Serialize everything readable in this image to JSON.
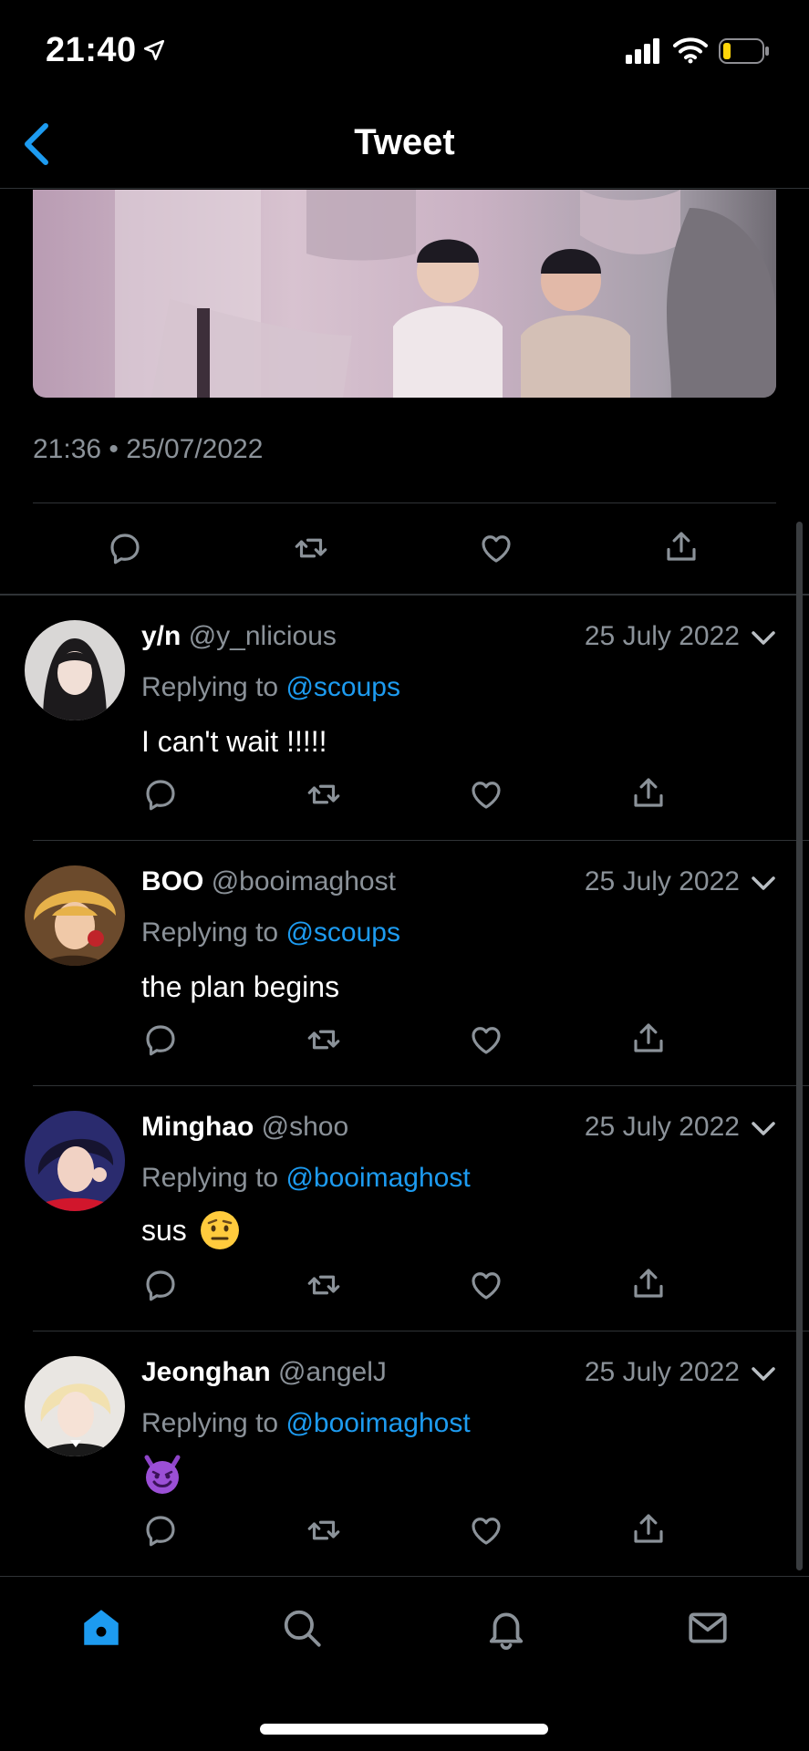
{
  "status_bar": {
    "time": "21:40"
  },
  "header": {
    "title": "Tweet"
  },
  "tweet": {
    "timestamp": "21:36 • 25/07/2022"
  },
  "replies": [
    {
      "name": "y/n",
      "handle": "@y_nlicious",
      "date": "25 July 2022",
      "replying_label": "Replying to",
      "replying_to": "@scoups",
      "text": "I can't wait !!!!!"
    },
    {
      "name": "BOO",
      "handle": "@booimaghost",
      "date": "25 July 2022",
      "replying_label": "Replying to",
      "replying_to": "@scoups",
      "text": "the plan begins"
    },
    {
      "name": "Minghao",
      "handle": "@shoo",
      "date": "25 July 2022",
      "replying_label": "Replying to",
      "replying_to": "@booimaghost",
      "text": "sus"
    },
    {
      "name": "Jeonghan",
      "handle": "@angelJ",
      "date": "25 July 2022",
      "replying_label": "Replying to",
      "replying_to": "@booimaghost",
      "text": ""
    }
  ],
  "icons": {
    "reply": "reply-icon",
    "retweet": "retweet-icon",
    "like": "heart-icon",
    "share": "share-icon",
    "emoji_reply_3": "raised-eyebrow-emoji",
    "emoji_reply_4": "smiling-devil-emoji"
  },
  "nav": {
    "items": [
      "home-icon",
      "search-icon",
      "notifications-icon",
      "messages-icon"
    ],
    "active": "home-icon"
  },
  "colors": {
    "accent": "#1d9bf0",
    "muted": "#8b9299",
    "background": "#000000",
    "battery": "#ffd60a"
  }
}
